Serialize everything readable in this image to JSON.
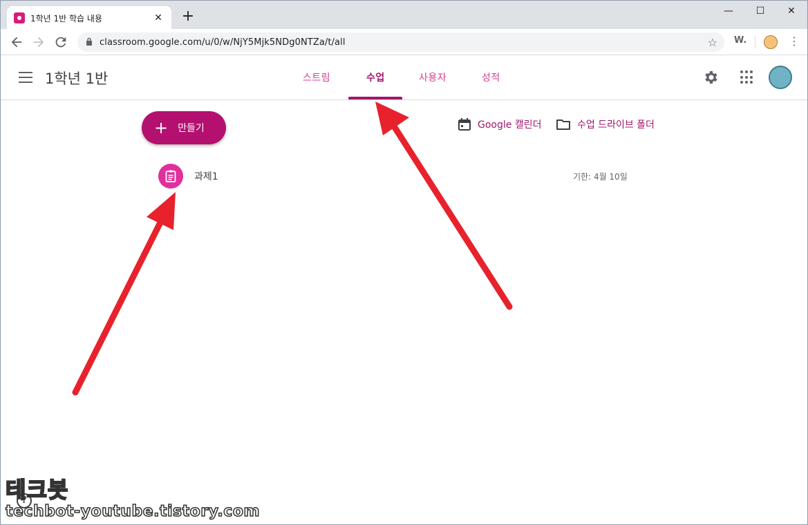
{
  "browser": {
    "tab_title": "1학년 1반 학습 내용",
    "tab_close": "✕",
    "new_tab": "+",
    "url": "classroom.google.com/u/0/w/NjY5Mjk5NDg0NTZa/t/all",
    "ext_label": "W.",
    "window_controls": {
      "minimize": "—",
      "maximize": "☐",
      "close": "✕"
    }
  },
  "app": {
    "class_title": "1학년 1반",
    "nav": [
      {
        "label": "스트림",
        "active": false
      },
      {
        "label": "수업",
        "active": true
      },
      {
        "label": "사용자",
        "active": false
      },
      {
        "label": "성적",
        "active": false
      }
    ]
  },
  "content": {
    "create_label": "만들기",
    "calendar_link": "Google 캘린더",
    "drive_link": "수업 드라이브 폴더",
    "assignments": [
      {
        "title": "과제1",
        "due": "기한: 4월 10일"
      }
    ]
  },
  "help": "?",
  "watermark": {
    "title": "테크봇",
    "url": "techbot-youtube.tistory.com"
  },
  "colors": {
    "accent": "#a0166b",
    "create_button": "#b3106f",
    "assignment_icon": "#e0309b",
    "arrow": "#e8222c"
  }
}
